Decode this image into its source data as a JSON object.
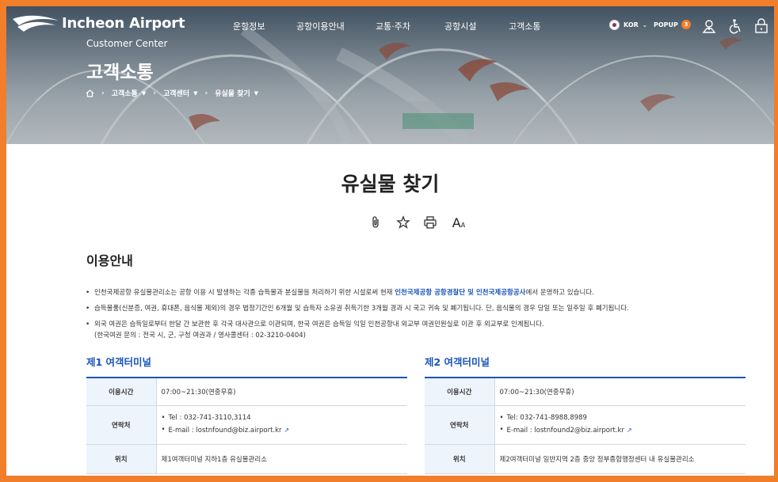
{
  "header": {
    "logo_text": "Incheon Airport",
    "subtitle": "Customer Center",
    "section_title": "고객소통",
    "nav": [
      "운항정보",
      "공항이용안내",
      "교통·주차",
      "공항시설",
      "고객소통"
    ],
    "lang_label": "KOR",
    "popup_label": "POPUP",
    "popup_count": "3",
    "breadcrumb": [
      "고객소통",
      "고객센터",
      "유실물 찾기"
    ]
  },
  "page": {
    "title": "유실물 찾기",
    "tools": [
      "clip-icon",
      "star-icon",
      "print-icon",
      "font-size-icon"
    ],
    "font_tool_label": "A",
    "font_tool_small": "A"
  },
  "section": {
    "title": "이용안내",
    "bullet1_pre": "인천국제공항 유실물관리소는 공항 이용 시 발생하는 각종 습득물과 분실물을 처리하기 위한 시설로써 현재 ",
    "bullet1_highlight": "인천국제공항 공항경찰단 및 인천국제공항공사",
    "bullet1_post": "에서 운영하고 있습니다.",
    "bullet2": "습득물품(신분증, 여권, 휴대폰, 음식물 제외)의 경우 법정기간인 6개월 및 습득자 소유권 취득기한 3개월 경과 시 국고 귀속 및 폐기됩니다. 단, 음식물의 경우 당일 또는 일주일 후 폐기됩니다.",
    "bullet3_line1": "외국 여권은 습득일로부터 한달 간 보관한 후 각국 대사관으로 이관되며, 한국 여권은 습득일 익일 인천공항내 외교부 여권민원실로 이관 후 외교부로 인계됩니다.",
    "bullet3_line2": "(한국여권 문의 : 전국 시, 군, 구청 여권과 / 영사콜센터 : 02-3210-0404)"
  },
  "terminals": [
    {
      "title": "제1 여객터미널",
      "hours_label": "이용시간",
      "hours": "07:00~21:30(연중무휴)",
      "contact_label": "연락처",
      "tel": "Tel : 032-741-3110,3114",
      "email": "E-mail : lostnfound@biz.airport.kr",
      "location_label": "위치",
      "location": "제1여객터미널 지하1층 유실물관리소"
    },
    {
      "title": "제2 여객터미널",
      "hours_label": "이용시간",
      "hours": "07:00~21:30(연중무휴)",
      "contact_label": "연락처",
      "tel": "Tel: 032-741-8988,8989",
      "email": "E-mail : lostnfound2@biz.airport.kr",
      "location_label": "위치",
      "location": "제2여객터미널 일반지역 2층 중앙 정부종합행정센터 내 유실물관리소"
    }
  ],
  "colors": {
    "accent": "#1a56b8",
    "frame": "#f07e2a",
    "badge": "#f07e2a",
    "table_head": "#eef4fb"
  }
}
